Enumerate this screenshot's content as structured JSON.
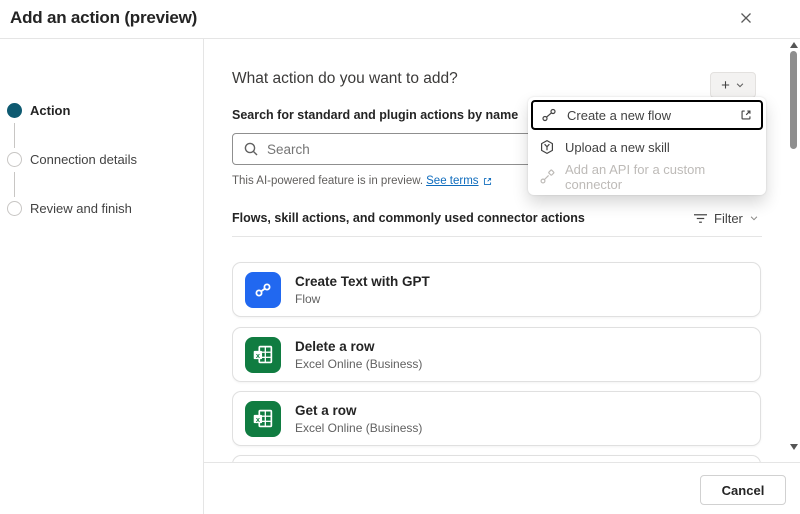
{
  "dialog": {
    "title": "Add an action (preview)"
  },
  "stepper": {
    "steps": [
      {
        "label": "Action",
        "state": "active"
      },
      {
        "label": "Connection details",
        "state": "pending"
      },
      {
        "label": "Review and finish",
        "state": "pending"
      }
    ]
  },
  "main": {
    "heading": "What action do you want to add?",
    "add_button": {
      "plus_label": "+"
    },
    "search_label": "Search for standard and plugin actions by name",
    "search": {
      "placeholder": "Search",
      "value": ""
    },
    "preview_note": "This AI-powered feature is in preview.",
    "preview_link": "See terms",
    "list_header": "Flows, skill actions, and commonly used connector actions",
    "filter_label": "Filter",
    "actions": [
      {
        "title": "Create Text with GPT",
        "subtitle": "Flow",
        "icon": "flow"
      },
      {
        "title": "Delete a row",
        "subtitle": "Excel Online (Business)",
        "icon": "excel"
      },
      {
        "title": "Get a row",
        "subtitle": "Excel Online (Business)",
        "icon": "excel"
      }
    ],
    "cancel_label": "Cancel"
  },
  "menu": {
    "items": [
      {
        "label": "Create a new flow",
        "icon": "flow-connector",
        "trailing_icon": "open-in-new",
        "state": "focused"
      },
      {
        "label": "Upload a new skill",
        "icon": "skill-cube",
        "state": "enabled"
      },
      {
        "label": "Add an API for a custom connector",
        "icon": "custom-connector",
        "state": "disabled"
      }
    ]
  },
  "colors": {
    "accent_step": "#0E5A71",
    "flow_icon_bg": "#2168F0",
    "excel_icon_bg": "#107C41",
    "link": "#0F6CBD",
    "text_primary": "#242424",
    "text_secondary": "#616161",
    "disabled": "#BDBAB7",
    "border": "#D1D1D1",
    "divider": "#E5E5E5"
  }
}
